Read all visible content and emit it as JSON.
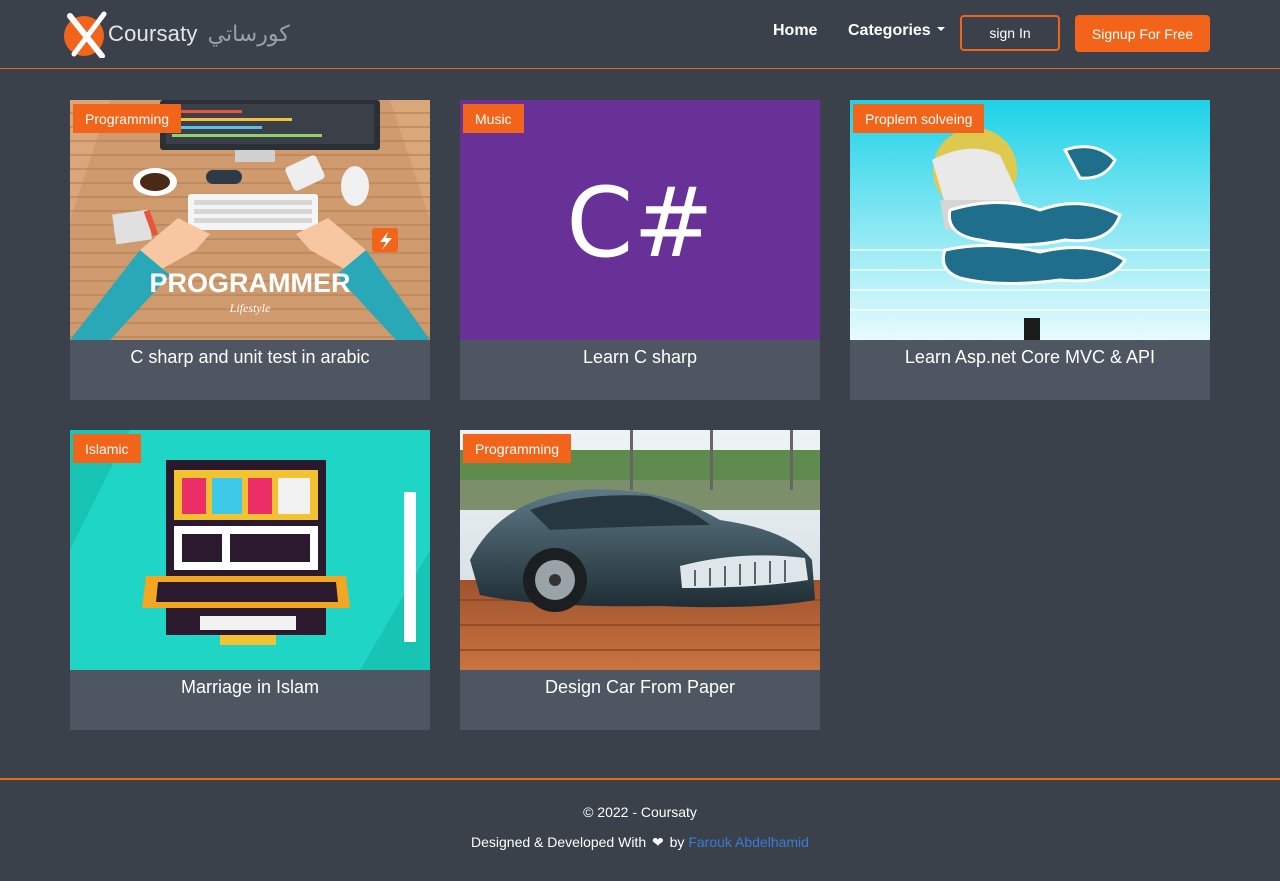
{
  "brand": {
    "name": "Coursaty",
    "name_ar": "كورساتي"
  },
  "nav": {
    "home": "Home",
    "categories": "Categories",
    "sign_in": "sign In",
    "signup": "Signup For Free"
  },
  "courses": [
    {
      "category": "Programming",
      "title": "C sharp and unit test in arabic",
      "image": "programmer-lifestyle-desk"
    },
    {
      "category": "Music",
      "title": "Learn C sharp",
      "image": "csharp-logo"
    },
    {
      "category": "Proplem solveing",
      "title": "Learn Asp.net Core MVC & API",
      "image": "arabic-calligraphy-sky"
    },
    {
      "category": "Islamic",
      "title": "Marriage in Islam",
      "image": "islamic-arabic-poster"
    },
    {
      "category": "Programming",
      "title": "Design Car From Paper",
      "image": "bmw-concept-car"
    }
  ],
  "images": {
    "programmer_text": "PROGRAMMER",
    "programmer_sub": "Lifestyle",
    "csharp_text": "C#"
  },
  "footer": {
    "copyright": "© 2022 - Coursaty",
    "credit_prefix": "Designed & Developed With",
    "credit_by": "by",
    "author": "Farouk Abdelhamid"
  },
  "colors": {
    "accent": "#f26419",
    "background": "#3a414b",
    "card": "#4e5661",
    "link": "#3a7bd5"
  }
}
